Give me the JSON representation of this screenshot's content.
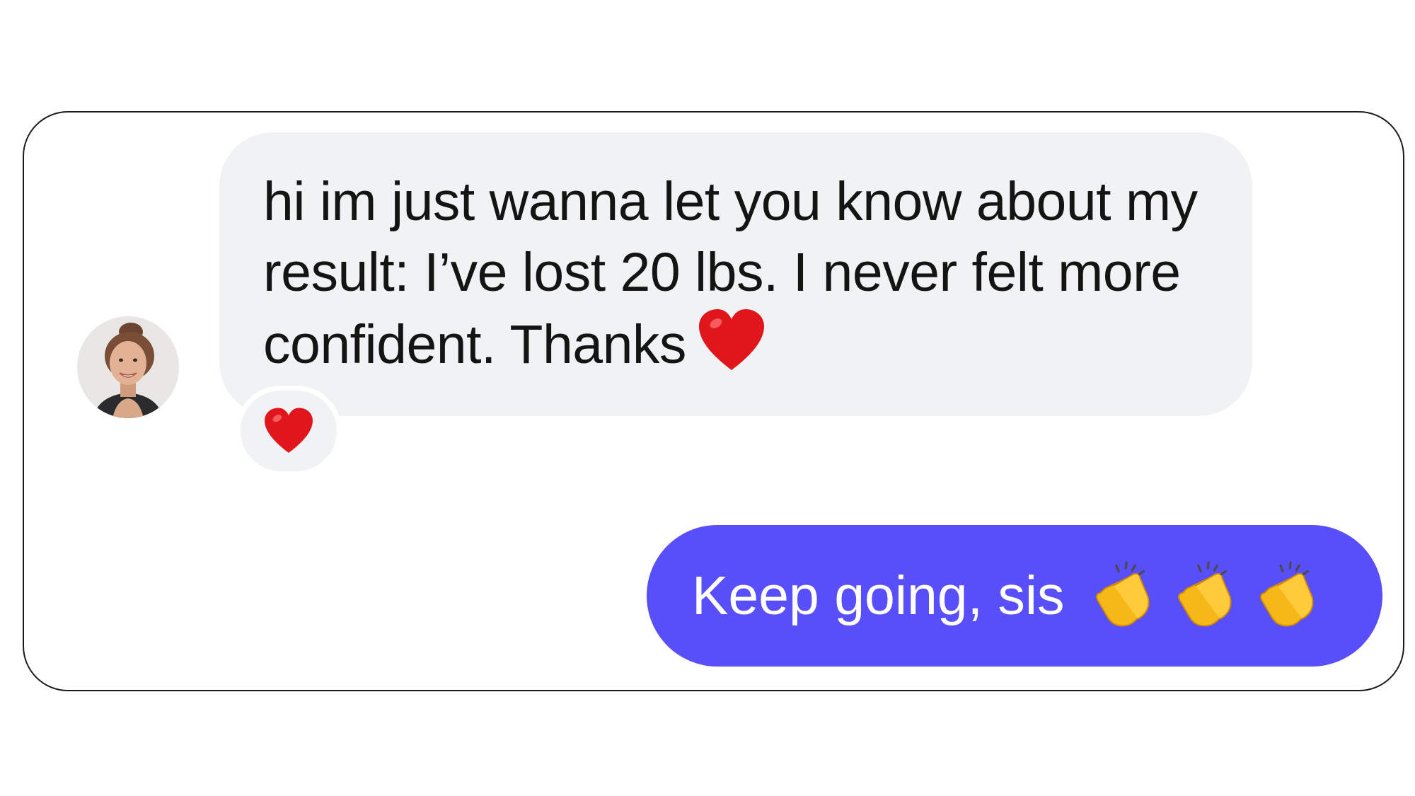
{
  "conversation": {
    "incoming": {
      "text": "hi im just wanna let you know about my result: I’ve lost 20 lbs. I never felt more confident. Thanks",
      "inline_emoji": "heart-icon",
      "reaction_emoji": "heart-icon",
      "bubble_color": "#f1f2f4"
    },
    "outgoing": {
      "text": "Keep going, sis",
      "emojis": [
        "clapping-hands-icon",
        "clapping-hands-icon",
        "clapping-hands-icon"
      ],
      "bubble_color": "#584ffb"
    }
  },
  "colors": {
    "heart": "#e0161c",
    "clap": "#f6b718",
    "text_dark": "#141414",
    "text_light": "#ffffff"
  }
}
